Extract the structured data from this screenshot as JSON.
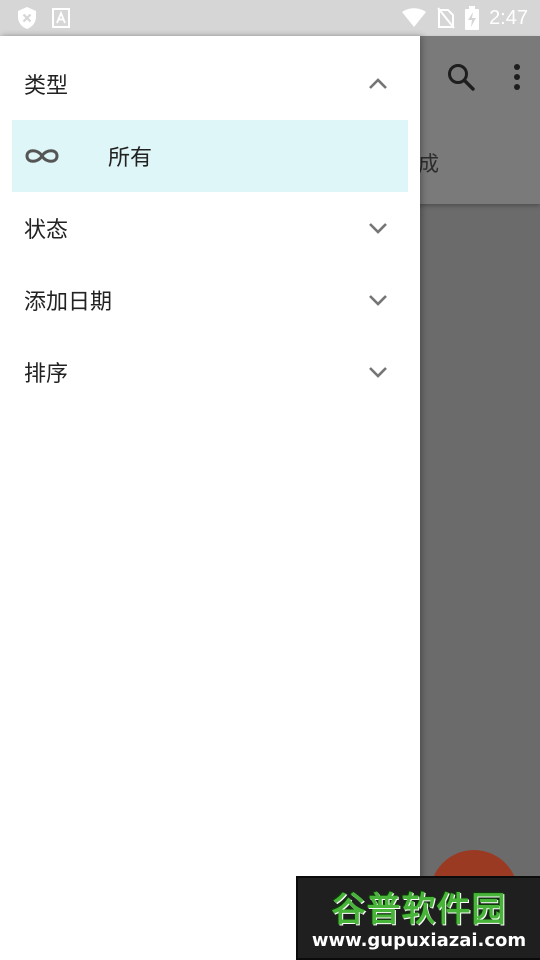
{
  "status_bar": {
    "time": "2:47",
    "left_icons": [
      "shield-x-icon",
      "font-a-icon"
    ],
    "right_icons": [
      "wifi-icon",
      "no-sim-icon",
      "battery-charging-icon"
    ]
  },
  "background_app": {
    "toolbar_actions": [
      "search-icon",
      "more-vert-icon"
    ],
    "partial_tab_text": "成"
  },
  "drawer": {
    "sections": [
      {
        "label": "类型",
        "expanded": true,
        "chevron": "chevron-up-icon"
      },
      {
        "label": "状态",
        "expanded": false,
        "chevron": "chevron-down-icon"
      },
      {
        "label": "添加日期",
        "expanded": false,
        "chevron": "chevron-down-icon"
      },
      {
        "label": "排序",
        "expanded": false,
        "chevron": "chevron-down-icon"
      }
    ],
    "selected_item": {
      "label": "所有",
      "icon": "infinity-icon"
    }
  },
  "watermark": {
    "title": "谷普软件园",
    "url": "www.gupuxiazai.com"
  },
  "colors": {
    "status_bar_bg": "#d6d6d6",
    "drawer_bg": "#ffffff",
    "selected_bg": "#def6f8",
    "scrim": "#6b6b6b",
    "fab": "#9b3a23"
  }
}
